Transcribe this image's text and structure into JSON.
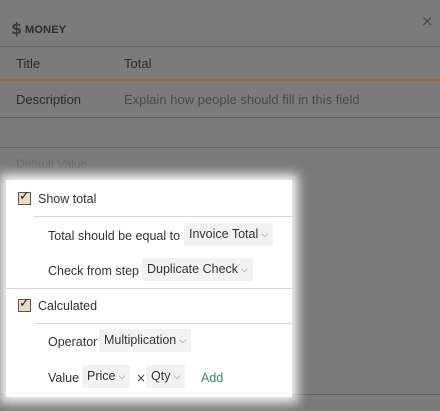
{
  "header": {
    "type_icon": "dollar-sign-icon",
    "type_label": "MONEY",
    "close_icon": "close-icon",
    "close_glyph": "×"
  },
  "fields": {
    "title": {
      "label": "Title",
      "value": "Total"
    },
    "description": {
      "label": "Description",
      "placeholder": "Explain how people should fill in this field"
    },
    "default_value": {
      "label": "Default Value"
    }
  },
  "options": {
    "show_total": {
      "label": "Show total",
      "checked": true,
      "equal_to_label": "Total should be equal to",
      "equal_to_value": "Invoice Total",
      "check_step_label": "Check from step",
      "check_step_value": "Duplicate Check"
    },
    "calculated": {
      "label": "Calculated",
      "checked": true,
      "operator_label": "Operator",
      "operator_value": "Multiplication",
      "value_label": "Value",
      "operand_1": "Price",
      "operator_symbol": "×",
      "operand_2": "Qty",
      "add_label": "Add"
    }
  },
  "colors": {
    "accent_underline": "#8a7430",
    "add_link": "#2f8b7e",
    "checkbox_fill": "#e9dcc0"
  }
}
